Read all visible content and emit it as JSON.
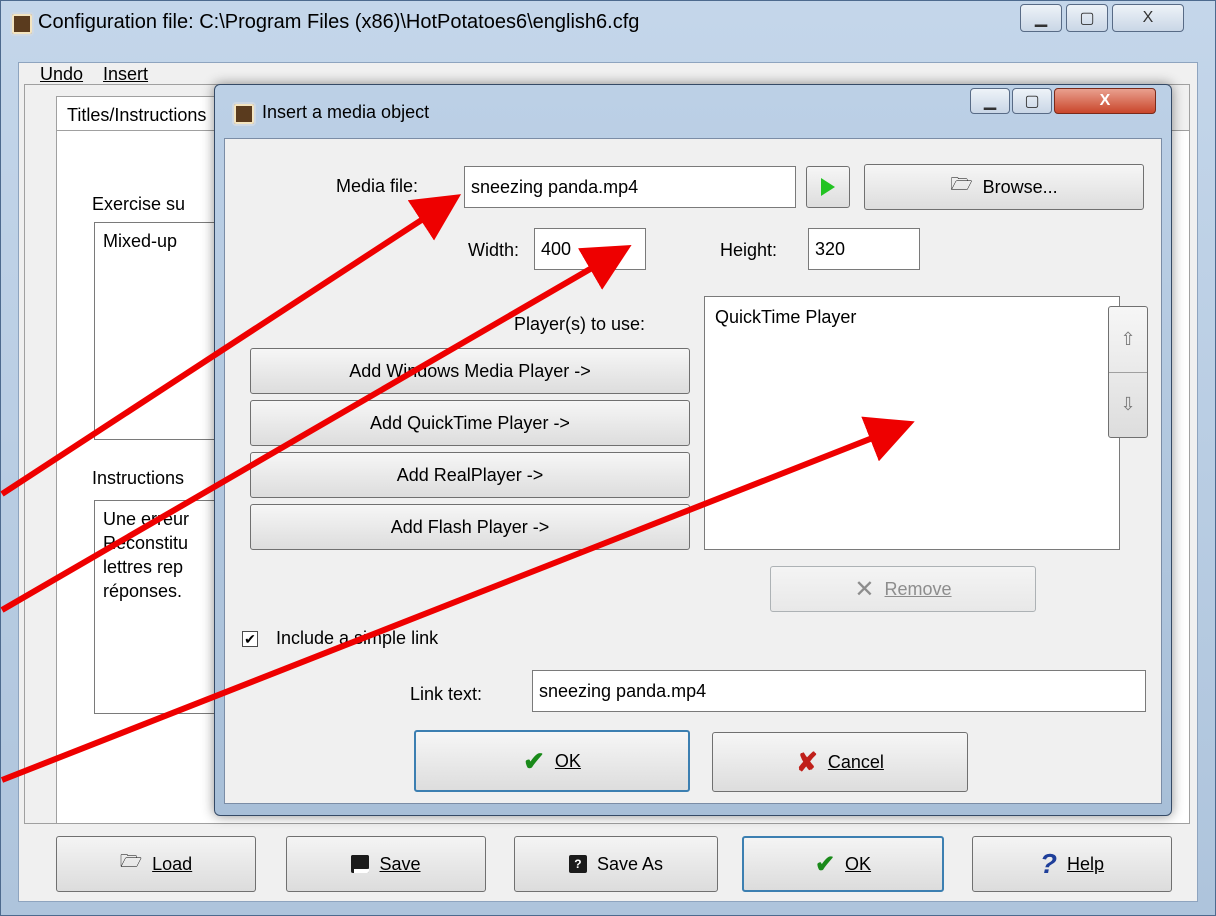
{
  "main_window": {
    "title": "Configuration file: C:\\Program Files (x86)\\HotPotatoes6\\english6.cfg",
    "controls": {
      "minimize": "▁",
      "maximize": "▢",
      "close": "X"
    },
    "menu": [
      "Undo",
      "Insert"
    ],
    "active_tab": "Titles/Instructions",
    "exercise_subtitle_label": "Exercise su",
    "exercise_subtitle_value": "Mixed-up",
    "instructions_label": "Instructions",
    "instructions_lines": [
      "Une erreur",
      "Reconstitu",
      "lettres rep",
      "réponses."
    ],
    "buttons": {
      "load": "Load",
      "save": "Save",
      "save_as": "Save As",
      "ok": "OK",
      "help": "Help"
    }
  },
  "dialog": {
    "title": "Insert a media object",
    "media_file_label": "Media file:",
    "media_file_value": "sneezing panda.mp4",
    "browse_label": "Browse...",
    "width_label": "Width:",
    "width_value": "400",
    "height_label": "Height:",
    "height_value": "320",
    "players_label": "Player(s) to use:",
    "players_list": [
      "QuickTime Player"
    ],
    "add_buttons": [
      "Add Windows Media Player ->",
      "Add QuickTime Player ->",
      "Add RealPlayer ->",
      "Add Flash Player ->"
    ],
    "remove_label": "Remove",
    "include_link_label": "Include a simple link",
    "include_link_checked": true,
    "link_text_label": "Link text:",
    "link_text_value": "sneezing panda.mp4",
    "ok_label": "OK",
    "cancel_label": "Cancel"
  },
  "colors": {
    "annotation_arrow": "#ee0000",
    "play_green": "#22c322",
    "ok_check": "#1a8a1a",
    "cancel_x": "#c0201a"
  }
}
